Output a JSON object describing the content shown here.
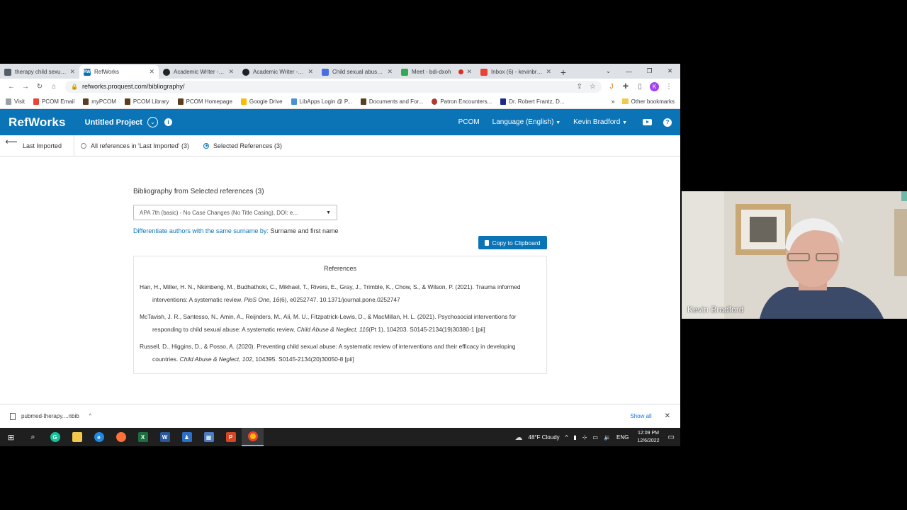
{
  "browser": {
    "tabs": [
      {
        "title": "therapy child sexual a",
        "favicon_color": "#555e6b",
        "active": false,
        "recording": false
      },
      {
        "title": "RefWorks",
        "favicon_color": "#0b74b7",
        "favicon_text": "RW",
        "active": true,
        "recording": false
      },
      {
        "title": "Academic Writer - Ho",
        "favicon_color": "#222222",
        "active": false,
        "recording": false
      },
      {
        "title": "Academic Writer - Bu",
        "favicon_color": "#222222",
        "active": false,
        "recording": false
      },
      {
        "title": "Child sexual abuse - D",
        "favicon_color": "#4a6ee0",
        "active": false,
        "recording": false
      },
      {
        "title": "Meet - bdi-dxoh",
        "favicon_color": "#34a853",
        "active": false,
        "recording": true
      },
      {
        "title": "Inbox (6) - kevinbr2@",
        "favicon_color": "#ea4335",
        "active": false,
        "recording": false
      }
    ],
    "url": "refworks.proquest.com/bibliography/",
    "profile_initial": "K",
    "bookmarks": [
      {
        "label": "Visit",
        "color": "#9aa0a6"
      },
      {
        "label": "PCOM Email",
        "color": "#ea4335"
      },
      {
        "label": "myPCOM",
        "color": "#5c3d1e"
      },
      {
        "label": "PCOM Library",
        "color": "#5c3d1e"
      },
      {
        "label": "PCOM Homepage",
        "color": "#5c3d1e"
      },
      {
        "label": "Google Drive",
        "color": "#fbbc04"
      },
      {
        "label": "LibApps Login @ P...",
        "color": "#4a90d9"
      },
      {
        "label": "Documents and For...",
        "color": "#5c3d1e"
      },
      {
        "label": "Patron Encounters...",
        "color": "#b03a2e"
      },
      {
        "label": "Dr. Robert Frantz, D...",
        "color": "#1a2b8c"
      }
    ],
    "bookmarks_more": "»",
    "other_bookmarks": "Other bookmarks"
  },
  "app": {
    "logo": "RefWorks",
    "project": "Untitled Project",
    "nav_right": {
      "institution": "PCOM",
      "language": "Language (English)",
      "user": "Kevin Bradford"
    },
    "subnav": {
      "folder": "Last Imported",
      "option_all": "All references in 'Last Imported' (3)",
      "option_selected": "Selected References (3)"
    }
  },
  "bibliography": {
    "title": "Bibliography from Selected references (3)",
    "style_value": "APA 7th (basic) - No Case Changes (No Title Casing), DOI: e...",
    "differentiate_label": "Differentiate authors with the same surname by:",
    "differentiate_value": "Surname and first name",
    "copy_button": "Copy to Clipboard",
    "references_header": "References",
    "references": [
      {
        "pre": "Han, H., Miller, H. N., Nkimbeng, M., Budhathoki, C., Mikhael, T., Rivers, E., Gray, J., Trimble, K., Chow, S., & Wilson, P. (2021). Trauma informed interventions: A systematic review. ",
        "source": "PloS One, 16",
        "post": "(6), e0252747. 10.1371/journal.pone.0252747"
      },
      {
        "pre": "McTavish, J. R., Santesso, N., Amin, A., Reijnders, M., Ali, M. U., Fitzpatrick-Lewis, D., & MacMillan, H. L. (2021). Psychosocial interventions for responding to child sexual abuse: A systematic review. ",
        "source": "Child Abuse & Neglect, 116",
        "post": "(Pt 1), 104203. S0145-2134(19)30380-1 [pii]"
      },
      {
        "pre": "Russell, D., Higgins, D., & Posso, A. (2020). Preventing child sexual abuse: A systematic review of interventions and their efficacy in developing countries. ",
        "source": "Child Abuse & Neglect, 102",
        "post": ", 104395. S0145-2134(20)30050-8 [pii]"
      }
    ]
  },
  "download_bar": {
    "file": "pubmed-therapy....nbib",
    "show_all": "Show all"
  },
  "taskbar": {
    "weather": "48°F  Cloudy",
    "lang": "ENG",
    "time": "12:09 PM",
    "date": "12/6/2022"
  },
  "webcam": {
    "name": "Kevin Bradford"
  }
}
